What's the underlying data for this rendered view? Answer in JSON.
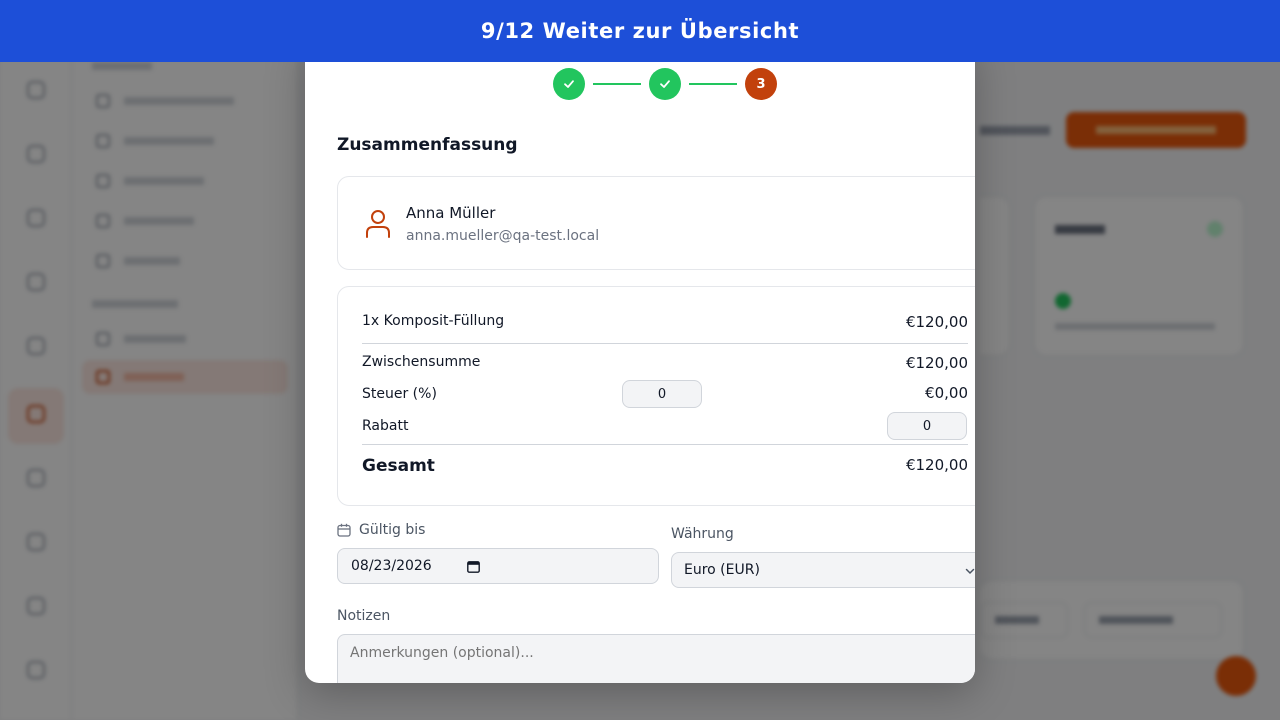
{
  "banner": {
    "text": "9/12 Weiter zur Übersicht"
  },
  "stepper": {
    "current_step_label": "3"
  },
  "summary": {
    "title": "Zusammenfassung",
    "customer": {
      "name": "Anna Müller",
      "email": "anna.mueller@qa-test.local"
    },
    "line_items": [
      {
        "label": "1x Komposit-Füllung",
        "amount": "€120,00"
      }
    ],
    "subtotal": {
      "label": "Zwischensumme",
      "amount": "€120,00"
    },
    "tax": {
      "label": "Steuer (%)",
      "input_value": "0",
      "amount": "€0,00"
    },
    "discount": {
      "label": "Rabatt",
      "input_value": "0"
    },
    "total": {
      "label": "Gesamt",
      "amount": "€120,00"
    }
  },
  "valid_until": {
    "label": "Gültig bis",
    "value": "08/23/2026"
  },
  "currency": {
    "label": "Währung",
    "selected": "Euro (EUR)"
  },
  "notes": {
    "label": "Notizen",
    "placeholder": "Anmerkungen (optional)..."
  },
  "colors": {
    "banner": "#1d4fd8",
    "accent": "#c2410c",
    "success": "#22c55e"
  }
}
